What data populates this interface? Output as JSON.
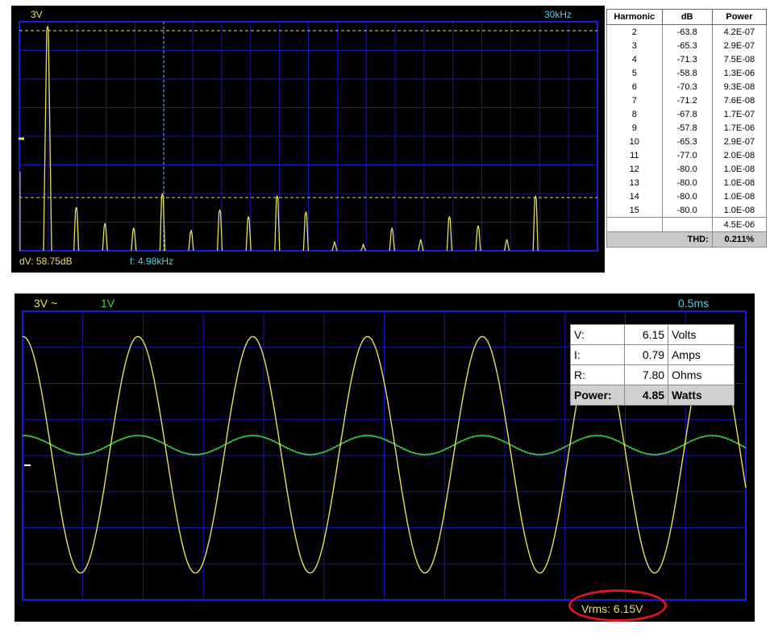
{
  "fft_scope": {
    "volts_label": "3V",
    "freq_label": "30kHz",
    "dv_label": "dV: 58.75dB",
    "f_label": "f: 4.98kHz",
    "trace_color": "#e6e05a",
    "cursor_color": "#4fd2e0",
    "grid_color": "#1c1cd6",
    "peaks": [
      0.98,
      0.19,
      0.12,
      0.1,
      0.25,
      0.09,
      0.18,
      0.15,
      0.24,
      0.17,
      0.04,
      0.03,
      0.1,
      0.05,
      0.15,
      0.11,
      0.05,
      0.24
    ]
  },
  "harmonics_table": {
    "headers": [
      "Harmonic",
      "dB",
      "Power"
    ],
    "rows": [
      [
        "2",
        "-63.8",
        "4.2E-07"
      ],
      [
        "3",
        "-65.3",
        "2.9E-07"
      ],
      [
        "4",
        "-71.3",
        "7.5E-08"
      ],
      [
        "5",
        "-58.8",
        "1.3E-06"
      ],
      [
        "6",
        "-70.3",
        "9.3E-08"
      ],
      [
        "7",
        "-71.2",
        "7.6E-08"
      ],
      [
        "8",
        "-67.8",
        "1.7E-07"
      ],
      [
        "9",
        "-57.8",
        "1.7E-06"
      ],
      [
        "10",
        "-65.3",
        "2.9E-07"
      ],
      [
        "11",
        "-77.0",
        "2.0E-08"
      ],
      [
        "12",
        "-80.0",
        "1.0E-08"
      ],
      [
        "13",
        "-80.0",
        "1.0E-08"
      ],
      [
        "14",
        "-80.0",
        "1.0E-08"
      ],
      [
        "15",
        "-80.0",
        "1.0E-08"
      ]
    ],
    "total_power": "4.5E-06",
    "thd_label": "THD:",
    "thd_value": "0.211%"
  },
  "time_scope": {
    "ch1_label": "3V ~",
    "ch2_label": "1V",
    "timebase_label": "0.5ms",
    "vrms_label": "Vrms: 6.15V",
    "ch1_color": "#e6e05a",
    "ch2_color": "#44d44a",
    "grid_color": "#1c1cd6",
    "ch1_cycles": 6.3,
    "ch1_amplitude": 0.78,
    "ch2_amplitude": 0.11
  },
  "power_table": {
    "rows": [
      [
        "V:",
        "6.15",
        "Volts"
      ],
      [
        "I:",
        "0.79",
        "Amps"
      ],
      [
        "R:",
        "7.80",
        "Ohms"
      ]
    ],
    "total": [
      "Power:",
      "4.85",
      "Watts"
    ]
  }
}
